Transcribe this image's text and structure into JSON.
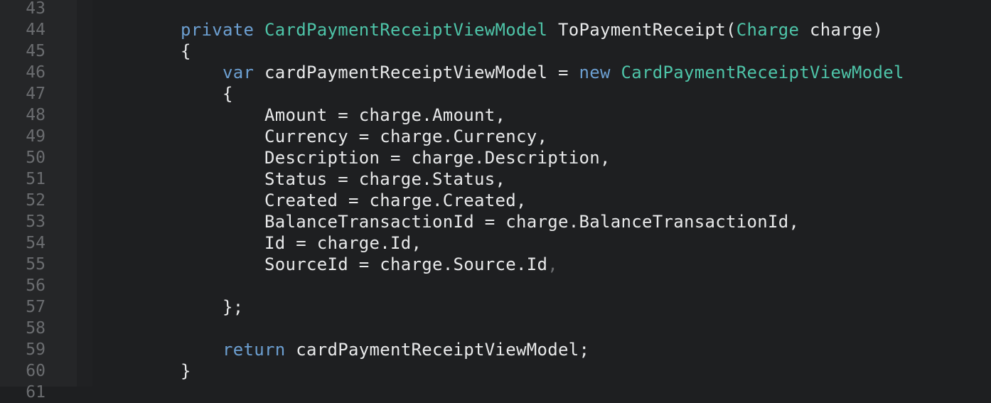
{
  "editor": {
    "lines": [
      {
        "num": "43",
        "tokens": []
      },
      {
        "num": "44",
        "tokens": [
          {
            "t": "private",
            "c": "kw"
          },
          {
            "t": " ",
            "c": "pl"
          },
          {
            "t": "CardPaymentReceiptViewModel",
            "c": "ty"
          },
          {
            "t": " ToPaymentReceipt(",
            "c": "pl"
          },
          {
            "t": "Charge",
            "c": "ty"
          },
          {
            "t": " charge)",
            "c": "pl"
          }
        ]
      },
      {
        "num": "45",
        "tokens": [
          {
            "t": "{",
            "c": "pl"
          }
        ]
      },
      {
        "num": "46",
        "tokens": [
          {
            "t": "    ",
            "c": "pl"
          },
          {
            "t": "var",
            "c": "kw"
          },
          {
            "t": " cardPaymentReceiptViewModel = ",
            "c": "pl"
          },
          {
            "t": "new",
            "c": "kw"
          },
          {
            "t": " ",
            "c": "pl"
          },
          {
            "t": "CardPaymentReceiptViewModel",
            "c": "ty"
          }
        ]
      },
      {
        "num": "47",
        "tokens": [
          {
            "t": "    {",
            "c": "pl"
          }
        ]
      },
      {
        "num": "48",
        "tokens": [
          {
            "t": "        Amount = charge.Amount,",
            "c": "pl"
          }
        ]
      },
      {
        "num": "49",
        "tokens": [
          {
            "t": "        Currency = charge.Currency,",
            "c": "pl"
          }
        ]
      },
      {
        "num": "50",
        "tokens": [
          {
            "t": "        Description = charge.Description,",
            "c": "pl"
          }
        ]
      },
      {
        "num": "51",
        "tokens": [
          {
            "t": "        Status = charge.Status,",
            "c": "pl"
          }
        ]
      },
      {
        "num": "52",
        "tokens": [
          {
            "t": "        Created = charge.Created,",
            "c": "pl"
          }
        ]
      },
      {
        "num": "53",
        "tokens": [
          {
            "t": "        BalanceTransactionId = charge.BalanceTransactionId,",
            "c": "pl"
          }
        ]
      },
      {
        "num": "54",
        "tokens": [
          {
            "t": "        Id = charge.Id,",
            "c": "pl"
          }
        ]
      },
      {
        "num": "55",
        "tokens": [
          {
            "t": "        SourceId = charge.Source.Id",
            "c": "pl"
          },
          {
            "t": ",",
            "c": "dim"
          }
        ]
      },
      {
        "num": "56",
        "tokens": []
      },
      {
        "num": "57",
        "tokens": [
          {
            "t": "    };",
            "c": "pl"
          }
        ]
      },
      {
        "num": "58",
        "tokens": []
      },
      {
        "num": "59",
        "tokens": [
          {
            "t": "    ",
            "c": "pl"
          },
          {
            "t": "return",
            "c": "kw"
          },
          {
            "t": " cardPaymentReceiptViewModel;",
            "c": "pl"
          }
        ]
      },
      {
        "num": "60",
        "tokens": [
          {
            "t": "}",
            "c": "pl"
          }
        ]
      },
      {
        "num": "61",
        "tokens": []
      }
    ]
  },
  "colors": {
    "background": "#1e1f21",
    "gutter": "#252628",
    "keyword": "#6c9fd1",
    "type": "#4ec4a8",
    "text": "#e8e9ea",
    "line_number": "#6b6d70"
  }
}
